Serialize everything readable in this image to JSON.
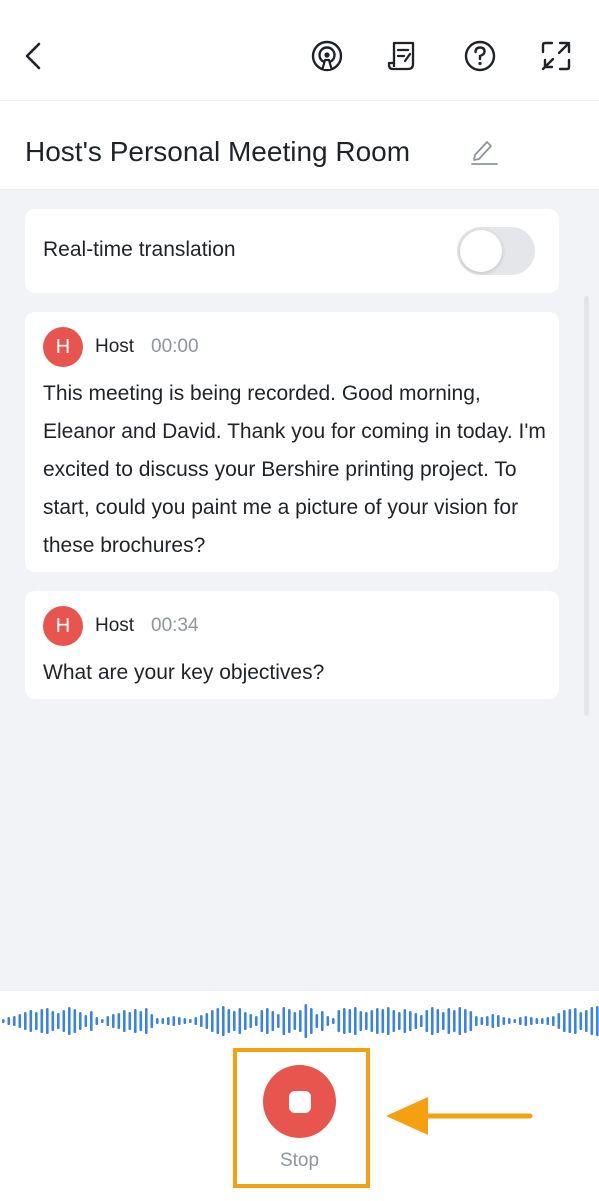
{
  "header": {
    "icons": [
      "back-icon",
      "podcast-icon",
      "notes-icon",
      "help-icon",
      "expand-icon"
    ]
  },
  "meeting": {
    "title": "Host's Personal Meeting Room"
  },
  "translation": {
    "label": "Real-time translation",
    "enabled": false
  },
  "transcript": [
    {
      "avatar": "H",
      "speaker": "Host",
      "time": "00:00",
      "text": "This meeting is being recorded. Good morning, Eleanor and David. Thank you for coming in today. I'm excited to discuss your Bershire printing project. To start, could you paint me a picture of your vision for these brochures?"
    },
    {
      "avatar": "H",
      "speaker": "Host",
      "time": "00:34",
      "text": "What are your key objectives?"
    }
  ],
  "controls": {
    "stop_label": "Stop"
  },
  "colors": {
    "accent_red": "#e8554e",
    "waveform_blue": "#3b82e6",
    "annotation_orange": "#f5a010"
  }
}
